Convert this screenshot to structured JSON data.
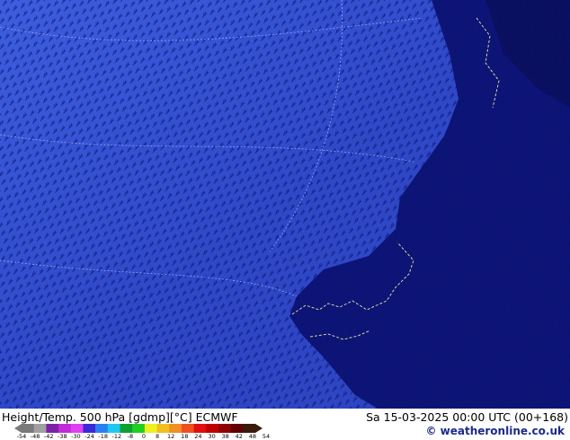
{
  "map": {
    "colors": {
      "ocean_light": "#3a56d8",
      "ocean_mid": "#2f47c8",
      "cold_airmass": "#0d1478",
      "contour": "#8ea0ff",
      "barb": "#0a0f55",
      "coast": "#e8e6a0"
    }
  },
  "footer": {
    "title": "Height/Temp. 500 hPa [gdmp][°C] ECMWF",
    "datetime": "Sa 15-03-2025 00:00 UTC (00+168)",
    "credit": "© weatheronline.co.uk"
  },
  "legend": {
    "ticks": [
      "-54",
      "-48",
      "-42",
      "-38",
      "-30",
      "-24",
      "-18",
      "-12",
      "-8",
      "0",
      "8",
      "12",
      "18",
      "24",
      "30",
      "38",
      "42",
      "48",
      "54"
    ],
    "colors": [
      "#7a7a7a",
      "#a0a0a0",
      "#7b22a8",
      "#c02ad8",
      "#e040f0",
      "#3a2ad8",
      "#2a80f0",
      "#20c8f0",
      "#10a030",
      "#20d020",
      "#f0f020",
      "#f0c020",
      "#f09020",
      "#f05020",
      "#e01010",
      "#c00000",
      "#900000",
      "#600000",
      "#3a1a0a"
    ]
  }
}
